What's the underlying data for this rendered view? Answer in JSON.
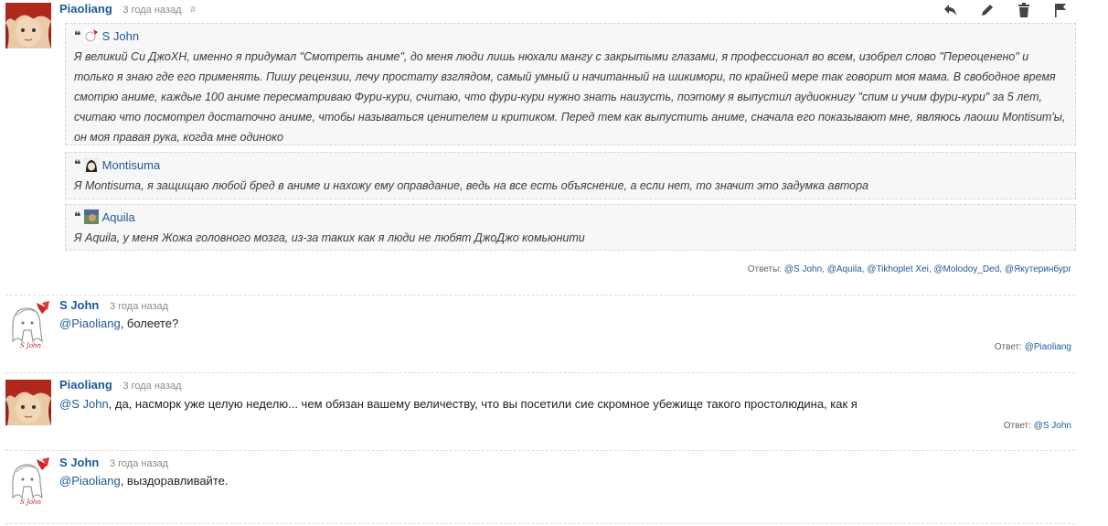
{
  "comments": [
    {
      "author": "Piaoliang",
      "time": "3 года назад",
      "hash": "#",
      "quotes": [
        {
          "author": "S John",
          "text": "Я великий Си ДжоХН, именно я придумал \"Смотреть аниме\", до меня люди лишь нюхали мангу с закрытыми глазами, я профессионал во всем, изобрел слово \"Переоценено\" и только я знаю где его применять. Пишу рецензии, лечу простату взглядом, самый умный и начитанный на шикимори, по крайней мере так говорит моя мама. В свободное время смотрю аниме, каждые 100 аниме пересматриваю Фури-кури, считаю, что фури-кури нужно знать наизусть, поэтому я выпустил аудиокнигу \"спим и учим фури-кури\" за 5 лет, считаю что посмотрел достаточно аниме, чтобы называться ценителем и критиком. Перед тем как выпустить аниме, сначала его показывают мне, являюсь лаоши Montisum'ы, он моя правая рука, когда мне одиноко"
        },
        {
          "author": "Montisuma",
          "text": "Я Montisuma, я защищаю любой бред в аниме и нахожу ему оправдание, ведь на все есть объяснение, а если нет, то значит это задумка автора"
        },
        {
          "author": "Aquila",
          "text": "Я Aquila, у меня Жожа головного мозга, из-за таких как я люди не любят ДжоДжо комьюнити"
        }
      ],
      "replies_label": "Ответы:",
      "replies": [
        "@S John",
        "@Aquila",
        "@Tikhoplet Xei",
        "@Molodoy_Ded",
        "@Якутеринбург"
      ]
    },
    {
      "author": "S John",
      "time": "3 года назад",
      "mention": "@Piaoliang",
      "text": ", болеете?",
      "replies_label": "Ответ:",
      "replies": [
        "@Piaoliang"
      ]
    },
    {
      "author": "Piaoliang",
      "time": "3 года назад",
      "mention": "@S John",
      "text": ", да, насморк уже целую неделю... чем обязан вашему величеству, что вы посетили сие скромное убежище такого простолюдина, как я",
      "replies_label": "Ответ:",
      "replies": [
        "@S John"
      ]
    },
    {
      "author": "S John",
      "time": "3 года назад",
      "mention": "@Piaoliang",
      "text": ", выздоравливайте."
    }
  ],
  "actions": [
    {
      "icon": "reply-icon"
    },
    {
      "icon": "pencil-icon"
    },
    {
      "icon": "trash-icon"
    },
    {
      "icon": "flag-icon"
    }
  ],
  "colors": {
    "link": "#1c5a99",
    "muted": "#8a8a8a",
    "quote_bg": "#f7f7f7"
  }
}
